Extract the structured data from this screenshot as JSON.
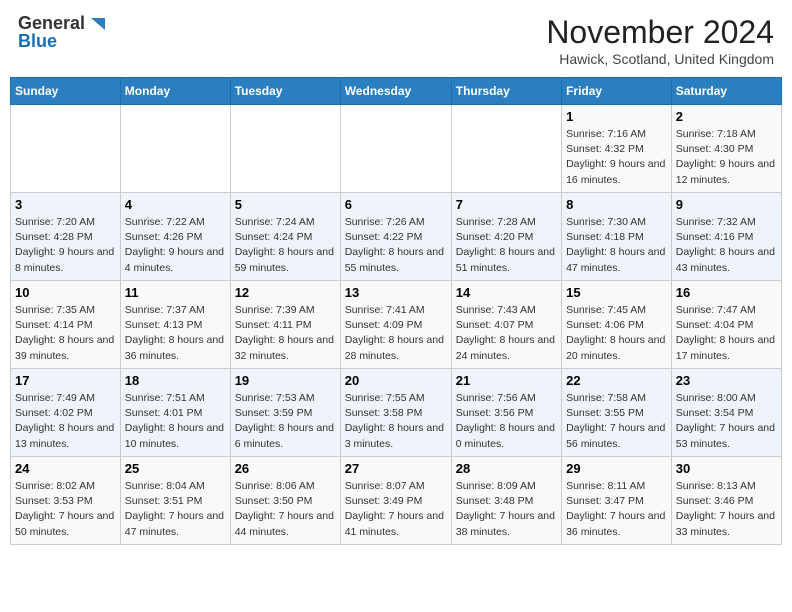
{
  "header": {
    "logo_general": "General",
    "logo_blue": "Blue",
    "month_title": "November 2024",
    "location": "Hawick, Scotland, United Kingdom"
  },
  "weekdays": [
    "Sunday",
    "Monday",
    "Tuesday",
    "Wednesday",
    "Thursday",
    "Friday",
    "Saturday"
  ],
  "weeks": [
    [
      {
        "day": "",
        "info": ""
      },
      {
        "day": "",
        "info": ""
      },
      {
        "day": "",
        "info": ""
      },
      {
        "day": "",
        "info": ""
      },
      {
        "day": "",
        "info": ""
      },
      {
        "day": "1",
        "info": "Sunrise: 7:16 AM\nSunset: 4:32 PM\nDaylight: 9 hours and 16 minutes."
      },
      {
        "day": "2",
        "info": "Sunrise: 7:18 AM\nSunset: 4:30 PM\nDaylight: 9 hours and 12 minutes."
      }
    ],
    [
      {
        "day": "3",
        "info": "Sunrise: 7:20 AM\nSunset: 4:28 PM\nDaylight: 9 hours and 8 minutes."
      },
      {
        "day": "4",
        "info": "Sunrise: 7:22 AM\nSunset: 4:26 PM\nDaylight: 9 hours and 4 minutes."
      },
      {
        "day": "5",
        "info": "Sunrise: 7:24 AM\nSunset: 4:24 PM\nDaylight: 8 hours and 59 minutes."
      },
      {
        "day": "6",
        "info": "Sunrise: 7:26 AM\nSunset: 4:22 PM\nDaylight: 8 hours and 55 minutes."
      },
      {
        "day": "7",
        "info": "Sunrise: 7:28 AM\nSunset: 4:20 PM\nDaylight: 8 hours and 51 minutes."
      },
      {
        "day": "8",
        "info": "Sunrise: 7:30 AM\nSunset: 4:18 PM\nDaylight: 8 hours and 47 minutes."
      },
      {
        "day": "9",
        "info": "Sunrise: 7:32 AM\nSunset: 4:16 PM\nDaylight: 8 hours and 43 minutes."
      }
    ],
    [
      {
        "day": "10",
        "info": "Sunrise: 7:35 AM\nSunset: 4:14 PM\nDaylight: 8 hours and 39 minutes."
      },
      {
        "day": "11",
        "info": "Sunrise: 7:37 AM\nSunset: 4:13 PM\nDaylight: 8 hours and 36 minutes."
      },
      {
        "day": "12",
        "info": "Sunrise: 7:39 AM\nSunset: 4:11 PM\nDaylight: 8 hours and 32 minutes."
      },
      {
        "day": "13",
        "info": "Sunrise: 7:41 AM\nSunset: 4:09 PM\nDaylight: 8 hours and 28 minutes."
      },
      {
        "day": "14",
        "info": "Sunrise: 7:43 AM\nSunset: 4:07 PM\nDaylight: 8 hours and 24 minutes."
      },
      {
        "day": "15",
        "info": "Sunrise: 7:45 AM\nSunset: 4:06 PM\nDaylight: 8 hours and 20 minutes."
      },
      {
        "day": "16",
        "info": "Sunrise: 7:47 AM\nSunset: 4:04 PM\nDaylight: 8 hours and 17 minutes."
      }
    ],
    [
      {
        "day": "17",
        "info": "Sunrise: 7:49 AM\nSunset: 4:02 PM\nDaylight: 8 hours and 13 minutes."
      },
      {
        "day": "18",
        "info": "Sunrise: 7:51 AM\nSunset: 4:01 PM\nDaylight: 8 hours and 10 minutes."
      },
      {
        "day": "19",
        "info": "Sunrise: 7:53 AM\nSunset: 3:59 PM\nDaylight: 8 hours and 6 minutes."
      },
      {
        "day": "20",
        "info": "Sunrise: 7:55 AM\nSunset: 3:58 PM\nDaylight: 8 hours and 3 minutes."
      },
      {
        "day": "21",
        "info": "Sunrise: 7:56 AM\nSunset: 3:56 PM\nDaylight: 8 hours and 0 minutes."
      },
      {
        "day": "22",
        "info": "Sunrise: 7:58 AM\nSunset: 3:55 PM\nDaylight: 7 hours and 56 minutes."
      },
      {
        "day": "23",
        "info": "Sunrise: 8:00 AM\nSunset: 3:54 PM\nDaylight: 7 hours and 53 minutes."
      }
    ],
    [
      {
        "day": "24",
        "info": "Sunrise: 8:02 AM\nSunset: 3:53 PM\nDaylight: 7 hours and 50 minutes."
      },
      {
        "day": "25",
        "info": "Sunrise: 8:04 AM\nSunset: 3:51 PM\nDaylight: 7 hours and 47 minutes."
      },
      {
        "day": "26",
        "info": "Sunrise: 8:06 AM\nSunset: 3:50 PM\nDaylight: 7 hours and 44 minutes."
      },
      {
        "day": "27",
        "info": "Sunrise: 8:07 AM\nSunset: 3:49 PM\nDaylight: 7 hours and 41 minutes."
      },
      {
        "day": "28",
        "info": "Sunrise: 8:09 AM\nSunset: 3:48 PM\nDaylight: 7 hours and 38 minutes."
      },
      {
        "day": "29",
        "info": "Sunrise: 8:11 AM\nSunset: 3:47 PM\nDaylight: 7 hours and 36 minutes."
      },
      {
        "day": "30",
        "info": "Sunrise: 8:13 AM\nSunset: 3:46 PM\nDaylight: 7 hours and 33 minutes."
      }
    ]
  ]
}
